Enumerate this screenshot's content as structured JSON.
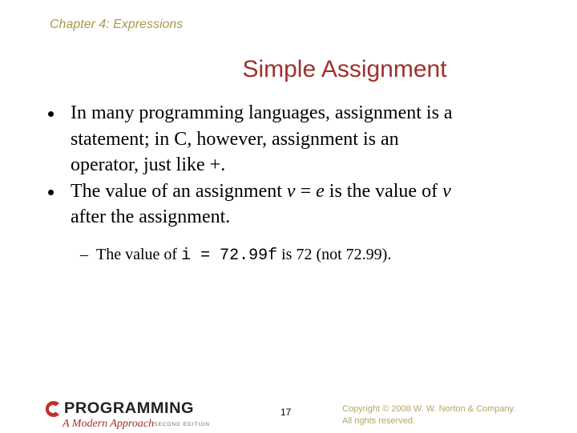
{
  "header": {
    "chapter": "Chapter 4: Expressions"
  },
  "slide": {
    "title": "Simple Assignment",
    "bullets": [
      {
        "lines": [
          "In many programming languages, assignment is a",
          "statement; in C, however, assignment is an",
          "operator, just like +."
        ]
      },
      {
        "pre": "The value of an assignment ",
        "var_v": "v",
        "eq": " = ",
        "var_e": "e",
        "mid": " is the value of ",
        "var_v2": "v",
        "line2": "after the assignment."
      }
    ],
    "sub_bullet": {
      "dash": "–",
      "pre": "The value of ",
      "code": "i = 72.99f",
      "post": " is 72 (not 72.99)."
    }
  },
  "footer": {
    "logo": {
      "letter": "C",
      "word": "PROGRAMMING",
      "subtitle": "A Modern Approach",
      "edition": "SECOND EDITION",
      "accent_color": "#c0302c"
    },
    "page_number": "17",
    "copyright_line1": "Copyright © 2008 W. W. Norton & Company.",
    "copyright_line2": "All rights reserved."
  },
  "colors": {
    "chapter": "#a89a48",
    "title": "#a0302e",
    "copyright": "#b3a660"
  }
}
